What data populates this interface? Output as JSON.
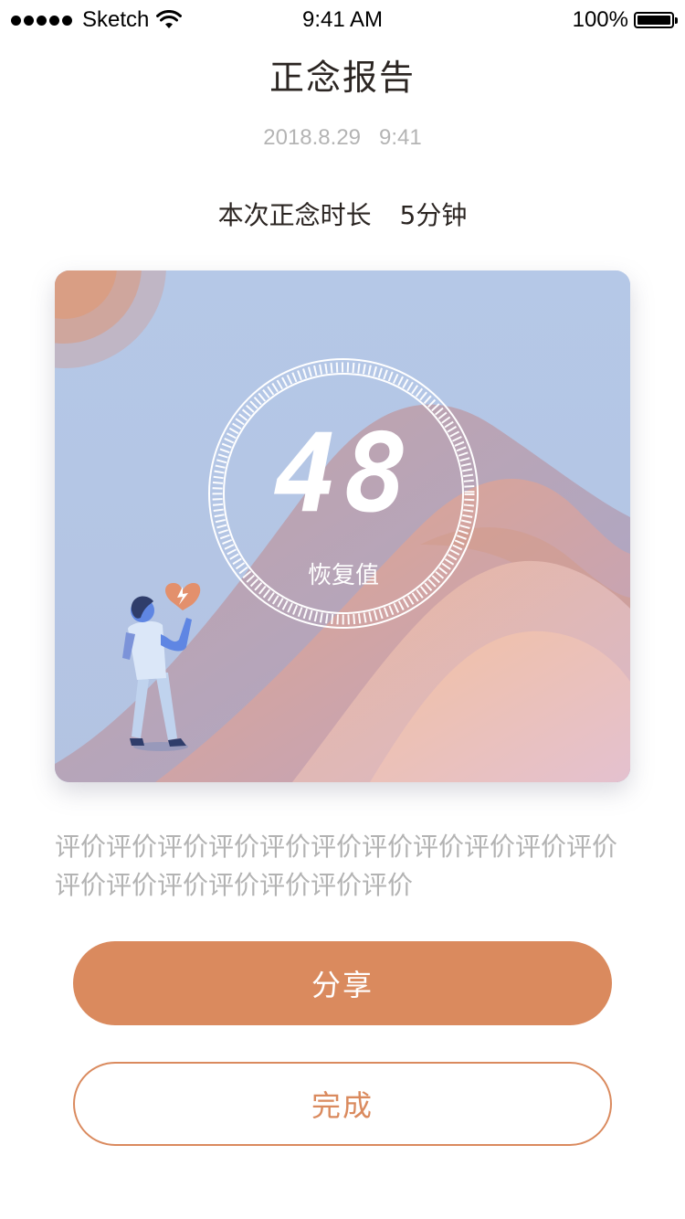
{
  "status_bar": {
    "carrier": "Sketch",
    "time": "9:41 AM",
    "battery": "100%"
  },
  "header": {
    "title": "正念报告",
    "date": "2018.8.29   9:41"
  },
  "session": {
    "duration_label": "本次正念时长",
    "duration_value": "5分钟"
  },
  "score_card": {
    "value": "48",
    "label": "恢复值"
  },
  "evaluation": "评价评价评价评价评价评价评价评价评价评价评价评价评价评价评价评价评价评价",
  "buttons": {
    "share": "分享",
    "done": "完成"
  },
  "colors": {
    "accent": "#da8a5e",
    "sky": "#b6c8e6",
    "title_text": "#2b2522",
    "muted_text": "#b3b3b3"
  }
}
